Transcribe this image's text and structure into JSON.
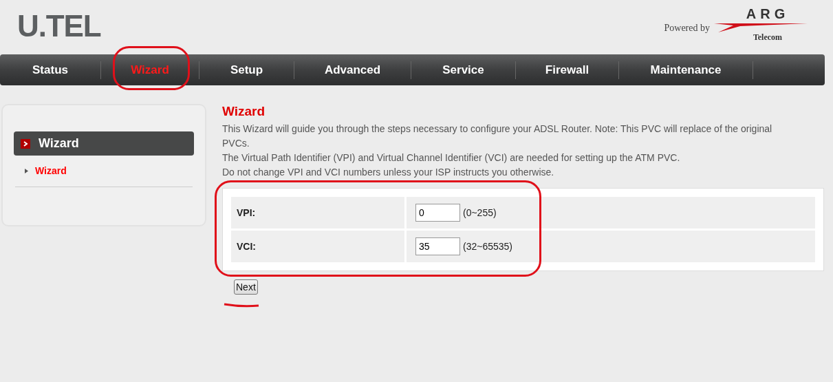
{
  "logo": {
    "text": "U.TEL"
  },
  "partner_logo": {
    "prefix": "Powered by",
    "name": "ARG",
    "subtitle": "Telecom"
  },
  "nav": [
    {
      "label": "Status",
      "selected": false
    },
    {
      "label": "Wizard",
      "selected": true
    },
    {
      "label": "Setup",
      "selected": false
    },
    {
      "label": "Advanced",
      "selected": false
    },
    {
      "label": "Service",
      "selected": false
    },
    {
      "label": "Firewall",
      "selected": false
    },
    {
      "label": "Maintenance",
      "selected": false
    }
  ],
  "sidebar": {
    "title": "Wizard",
    "items": [
      {
        "label": "Wizard",
        "selected": true
      }
    ]
  },
  "content": {
    "title": "Wizard",
    "paragraphs": [
      "This Wizard will guide you through the steps necessary to configure your ADSL Router. Note: This PVC will replace of the original PVCs.",
      "The Virtual Path Identifier (VPI) and Virtual Channel Identifier (VCI) are needed for setting up the ATM PVC.",
      "Do not change VPI and VCI numbers unless your ISP instructs you otherwise."
    ],
    "fields": [
      {
        "label": "VPI:",
        "value": "0",
        "range": "(0~255)"
      },
      {
        "label": "VCI:",
        "value": "35",
        "range": "(32~65535)"
      }
    ],
    "next_button": "Next"
  }
}
